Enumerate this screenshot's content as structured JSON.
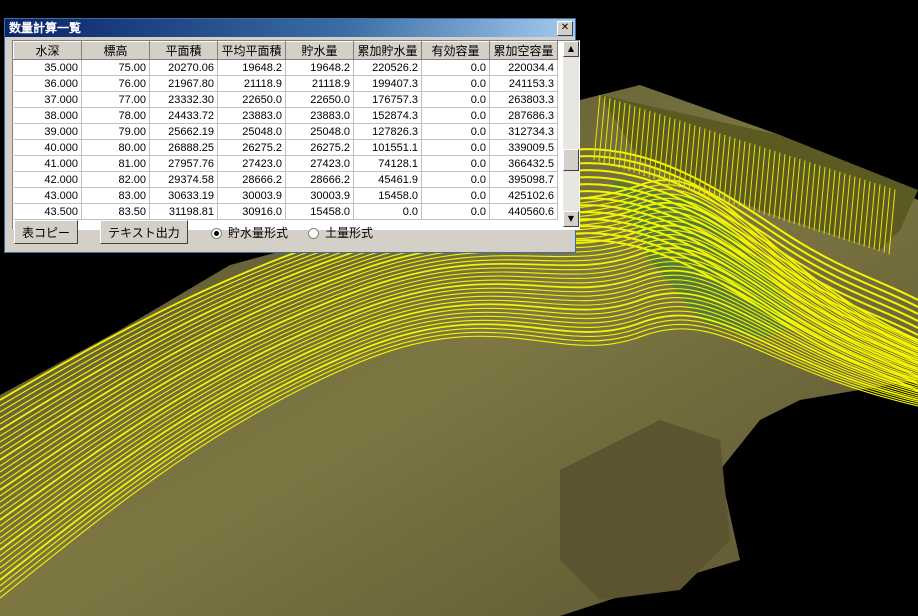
{
  "window": {
    "title": "数量計算一覧",
    "close_symbol": "✕"
  },
  "table": {
    "columns": [
      "水深",
      "標高",
      "平面積",
      "平均平面積",
      "貯水量",
      "累加貯水量",
      "有効容量",
      "累加空容量"
    ],
    "rows": [
      [
        "35.000",
        "75.00",
        "20270.06",
        "19648.2",
        "19648.2",
        "220526.2",
        "0.0",
        "220034.4"
      ],
      [
        "36.000",
        "76.00",
        "21967.80",
        "21118.9",
        "21118.9",
        "199407.3",
        "0.0",
        "241153.3"
      ],
      [
        "37.000",
        "77.00",
        "23332.30",
        "22650.0",
        "22650.0",
        "176757.3",
        "0.0",
        "263803.3"
      ],
      [
        "38.000",
        "78.00",
        "24433.72",
        "23883.0",
        "23883.0",
        "152874.3",
        "0.0",
        "287686.3"
      ],
      [
        "39.000",
        "79.00",
        "25662.19",
        "25048.0",
        "25048.0",
        "127826.3",
        "0.0",
        "312734.3"
      ],
      [
        "40.000",
        "80.00",
        "26888.25",
        "26275.2",
        "26275.2",
        "101551.1",
        "0.0",
        "339009.5"
      ],
      [
        "41.000",
        "81.00",
        "27957.76",
        "27423.0",
        "27423.0",
        "74128.1",
        "0.0",
        "366432.5"
      ],
      [
        "42.000",
        "82.00",
        "29374.58",
        "28666.2",
        "28666.2",
        "45461.9",
        "0.0",
        "395098.7"
      ],
      [
        "43.000",
        "83.00",
        "30633.19",
        "30003.9",
        "30003.9",
        "15458.0",
        "0.0",
        "425102.6"
      ],
      [
        "43.500",
        "83.50",
        "31198.81",
        "30916.0",
        "15458.0",
        "0.0",
        "0.0",
        "440560.6"
      ]
    ]
  },
  "buttons": {
    "copy": "表コピー",
    "text_output": "テキスト出力"
  },
  "radios": {
    "water_format": {
      "label": "貯水量形式",
      "selected": true
    },
    "earth_format": {
      "label": "土量形式",
      "selected": false
    }
  },
  "colors": {
    "contour": "#f5f500",
    "terrain": "#6e6a35",
    "background": "#000000",
    "titlebar": "#0a246a"
  }
}
